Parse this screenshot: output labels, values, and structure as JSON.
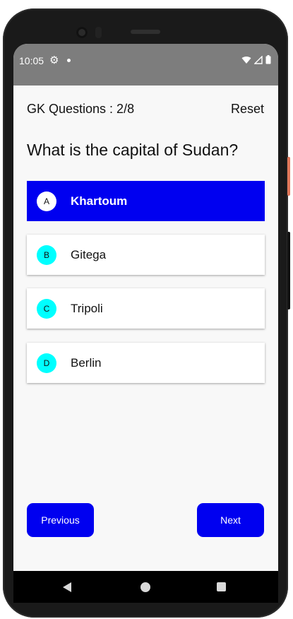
{
  "status_bar": {
    "time": "10:05"
  },
  "header": {
    "title": "GK Questions : 2/8",
    "reset_label": "Reset"
  },
  "question": "What is the capital of Sudan?",
  "options": [
    {
      "letter": "A",
      "label": "Khartoum",
      "selected": true
    },
    {
      "letter": "B",
      "label": "Gitega",
      "selected": false
    },
    {
      "letter": "C",
      "label": "Tripoli",
      "selected": false
    },
    {
      "letter": "D",
      "label": "Berlin",
      "selected": false
    }
  ],
  "navigation": {
    "previous_label": "Previous",
    "next_label": "Next"
  },
  "colors": {
    "accent": "#0000f0",
    "badge": "#00ffff",
    "status_bar": "#7d7d7d"
  }
}
